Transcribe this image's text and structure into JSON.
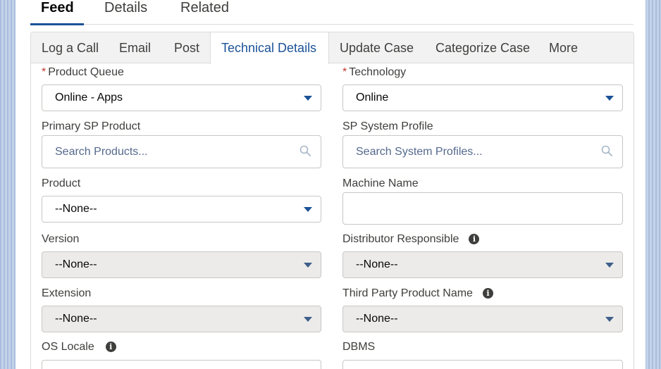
{
  "main_tabs": [
    "Feed",
    "Details",
    "Related"
  ],
  "publisher_tabs": [
    "Log a Call",
    "Email",
    "Post",
    "Technical Details",
    "Update Case",
    "Categorize Case",
    "More"
  ],
  "form": {
    "product_queue": {
      "label": "Product Queue",
      "value": "Online - Apps"
    },
    "technology": {
      "label": "Technology",
      "value": "Online"
    },
    "primary_sp_product": {
      "label": "Primary SP Product",
      "placeholder": "Search Products..."
    },
    "sp_system_profile": {
      "label": "SP System Profile",
      "placeholder": "Search System Profiles..."
    },
    "product": {
      "label": "Product",
      "value": "--None--"
    },
    "machine_name": {
      "label": "Machine Name",
      "value": ""
    },
    "version": {
      "label": "Version",
      "value": "--None--"
    },
    "distributor_responsible": {
      "label": "Distributor Responsible",
      "value": "--None--"
    },
    "extension": {
      "label": "Extension",
      "value": "--None--"
    },
    "third_party_product_name": {
      "label": "Third Party Product Name",
      "value": "--None--"
    },
    "os_locale": {
      "label": "OS Locale"
    },
    "dbms": {
      "label": "DBMS"
    }
  },
  "required_marker": "*",
  "info_glyph": "i",
  "colors": {
    "accent": "#1b5297",
    "disabled_bg": "#ecebea",
    "border": "#c9c7c5"
  }
}
